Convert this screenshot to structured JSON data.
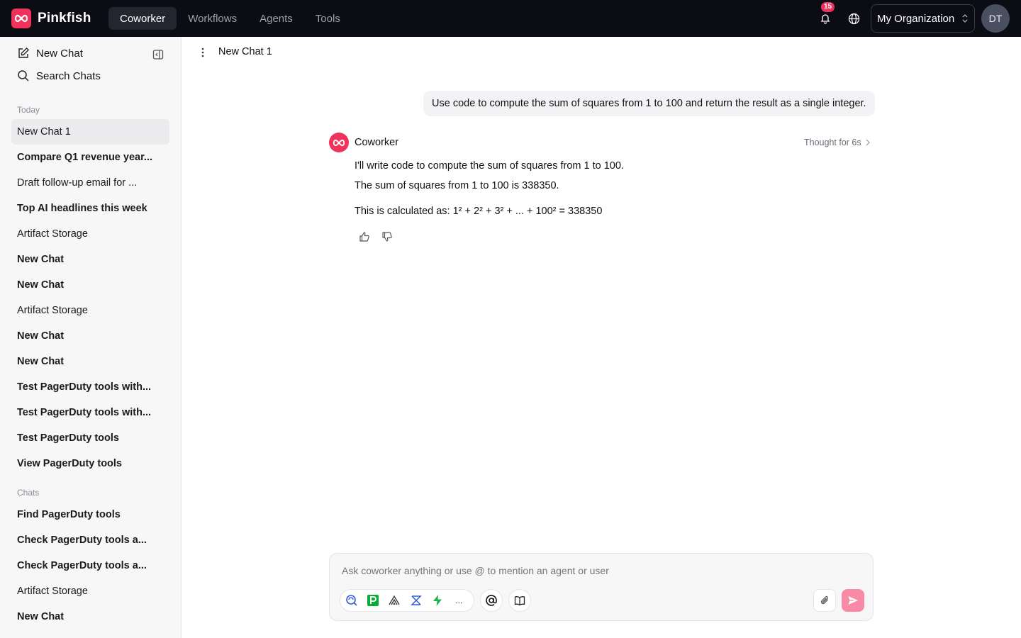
{
  "app": {
    "name": "Pinkfish",
    "accent_color": "#f0325c",
    "nav_tabs": [
      "Coworker",
      "Workflows",
      "Agents",
      "Tools"
    ],
    "active_tab": "Coworker",
    "notifications_count": "15",
    "organization": "My Organization",
    "user_initials": "DT"
  },
  "sidebar": {
    "new_chat_label": "New Chat",
    "search_label": "Search Chats",
    "today_label": "Today",
    "today_items": [
      {
        "label": "New Chat 1",
        "bold": false,
        "active": true
      },
      {
        "label": "Compare Q1 revenue year...",
        "bold": true
      },
      {
        "label": "Draft follow-up email for ...",
        "bold": false
      },
      {
        "label": "Top AI headlines this week",
        "bold": true
      },
      {
        "label": "Artifact Storage",
        "bold": false
      },
      {
        "label": "New Chat",
        "bold": true
      },
      {
        "label": "New Chat",
        "bold": true
      },
      {
        "label": "Artifact Storage",
        "bold": false
      },
      {
        "label": "New Chat",
        "bold": true
      },
      {
        "label": "New Chat",
        "bold": true
      },
      {
        "label": "Test PagerDuty tools with...",
        "bold": true
      },
      {
        "label": "Test PagerDuty tools with...",
        "bold": true
      },
      {
        "label": "Test PagerDuty tools",
        "bold": true
      },
      {
        "label": "View PagerDuty tools",
        "bold": true
      }
    ],
    "chats_label": "Chats",
    "chats_items": [
      {
        "label": "Find PagerDuty tools",
        "bold": true
      },
      {
        "label": "Check PagerDuty tools a...",
        "bold": true
      },
      {
        "label": "Check PagerDuty tools a...",
        "bold": true
      },
      {
        "label": "Artifact Storage",
        "bold": false
      },
      {
        "label": "New Chat",
        "bold": true
      }
    ]
  },
  "chat": {
    "title": "New Chat 1",
    "user_message": "Use code to compute the sum of squares from 1 to 100 and return the result as a single integer.",
    "assistant_name": "Coworker",
    "thought_label": "Thought for 6s",
    "assistant_lines": [
      "I'll write code to compute the sum of squares from 1 to 100.",
      "The sum of squares from 1 to 100 is 338350.",
      "This is calculated as: 1² + 2² + 3² + ... + 100² = 338350"
    ]
  },
  "composer": {
    "placeholder": "Ask coworker anything or use @ to mention an agent or user",
    "tools_more": "..."
  }
}
